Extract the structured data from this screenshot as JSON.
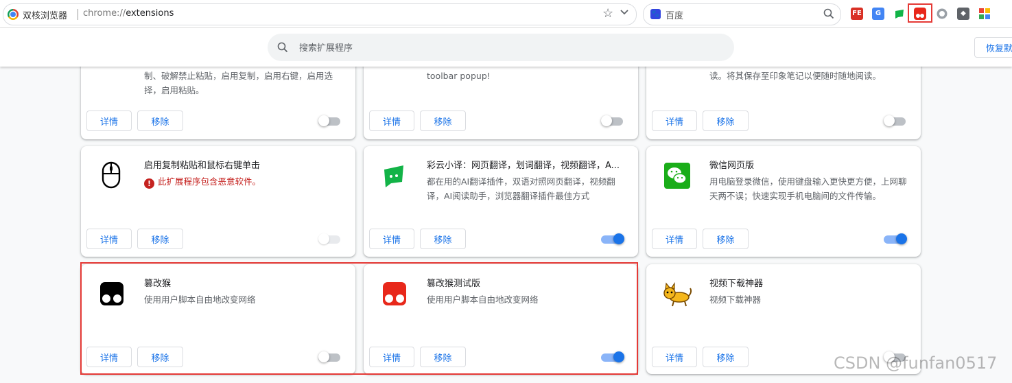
{
  "browser": {
    "name": "双核浏览器",
    "url_scheme": "chrome://",
    "url_path": "extensions",
    "search_engine": "百度"
  },
  "toolbar": {
    "search_placeholder": "搜索扩展程序",
    "restore_label": "恢复默"
  },
  "buttons": {
    "details": "详情",
    "remove": "移除"
  },
  "cards": [
    {
      "title": "",
      "desc": "制、破解禁止粘贴，启用复制，启用右键，启用选择，启用粘贴。",
      "icon": "partial-icon",
      "toggle": "off"
    },
    {
      "title": "",
      "desc": "toolbar popup!",
      "icon": "partial-icon",
      "toggle": "off"
    },
    {
      "title": "",
      "desc": "读。将其保存至印象笔记以便随时随地阅读。",
      "icon": "partial-icon",
      "toggle": "off"
    },
    {
      "title": "启用复制粘贴和鼠标右键单击",
      "warning": "此扩展程序包含恶意软件。",
      "icon": "mouse-icon",
      "toggle": "disabled"
    },
    {
      "title": "彩云小译：网页翻译，划词翻译，视频翻译，A...",
      "desc": "都在用的AI翻译插件，双语对照网页翻译，视频翻译，AI阅读助手，浏览器翻译插件最佳方式",
      "icon": "caiyun-icon",
      "toggle": "on"
    },
    {
      "title": "微信网页版",
      "desc": "用电脑登录微信，使用键盘输入更快更方便，上网聊天两不误；快速实现手机电脑间的文件传输。",
      "icon": "wechat-icon",
      "toggle": "on"
    },
    {
      "title": "篡改猴",
      "desc": "使用用户脚本自由地改变网络",
      "icon": "tampermonkey-icon",
      "toggle": "off"
    },
    {
      "title": "篡改猴测试版",
      "desc": "使用用户脚本自由地改变网络",
      "icon": "tampermonkey-beta-icon",
      "toggle": "on"
    },
    {
      "title": "视频下载神器",
      "desc": "视频下载神器",
      "icon": "cat-icon",
      "toggle": "off"
    }
  ],
  "extension_icons": {
    "fe": "FE",
    "translate": "G"
  },
  "colors": {
    "accent": "#1a73e8",
    "highlight": "#e53935",
    "warning": "#c5221f"
  },
  "watermark": "CSDN @funfan0517"
}
